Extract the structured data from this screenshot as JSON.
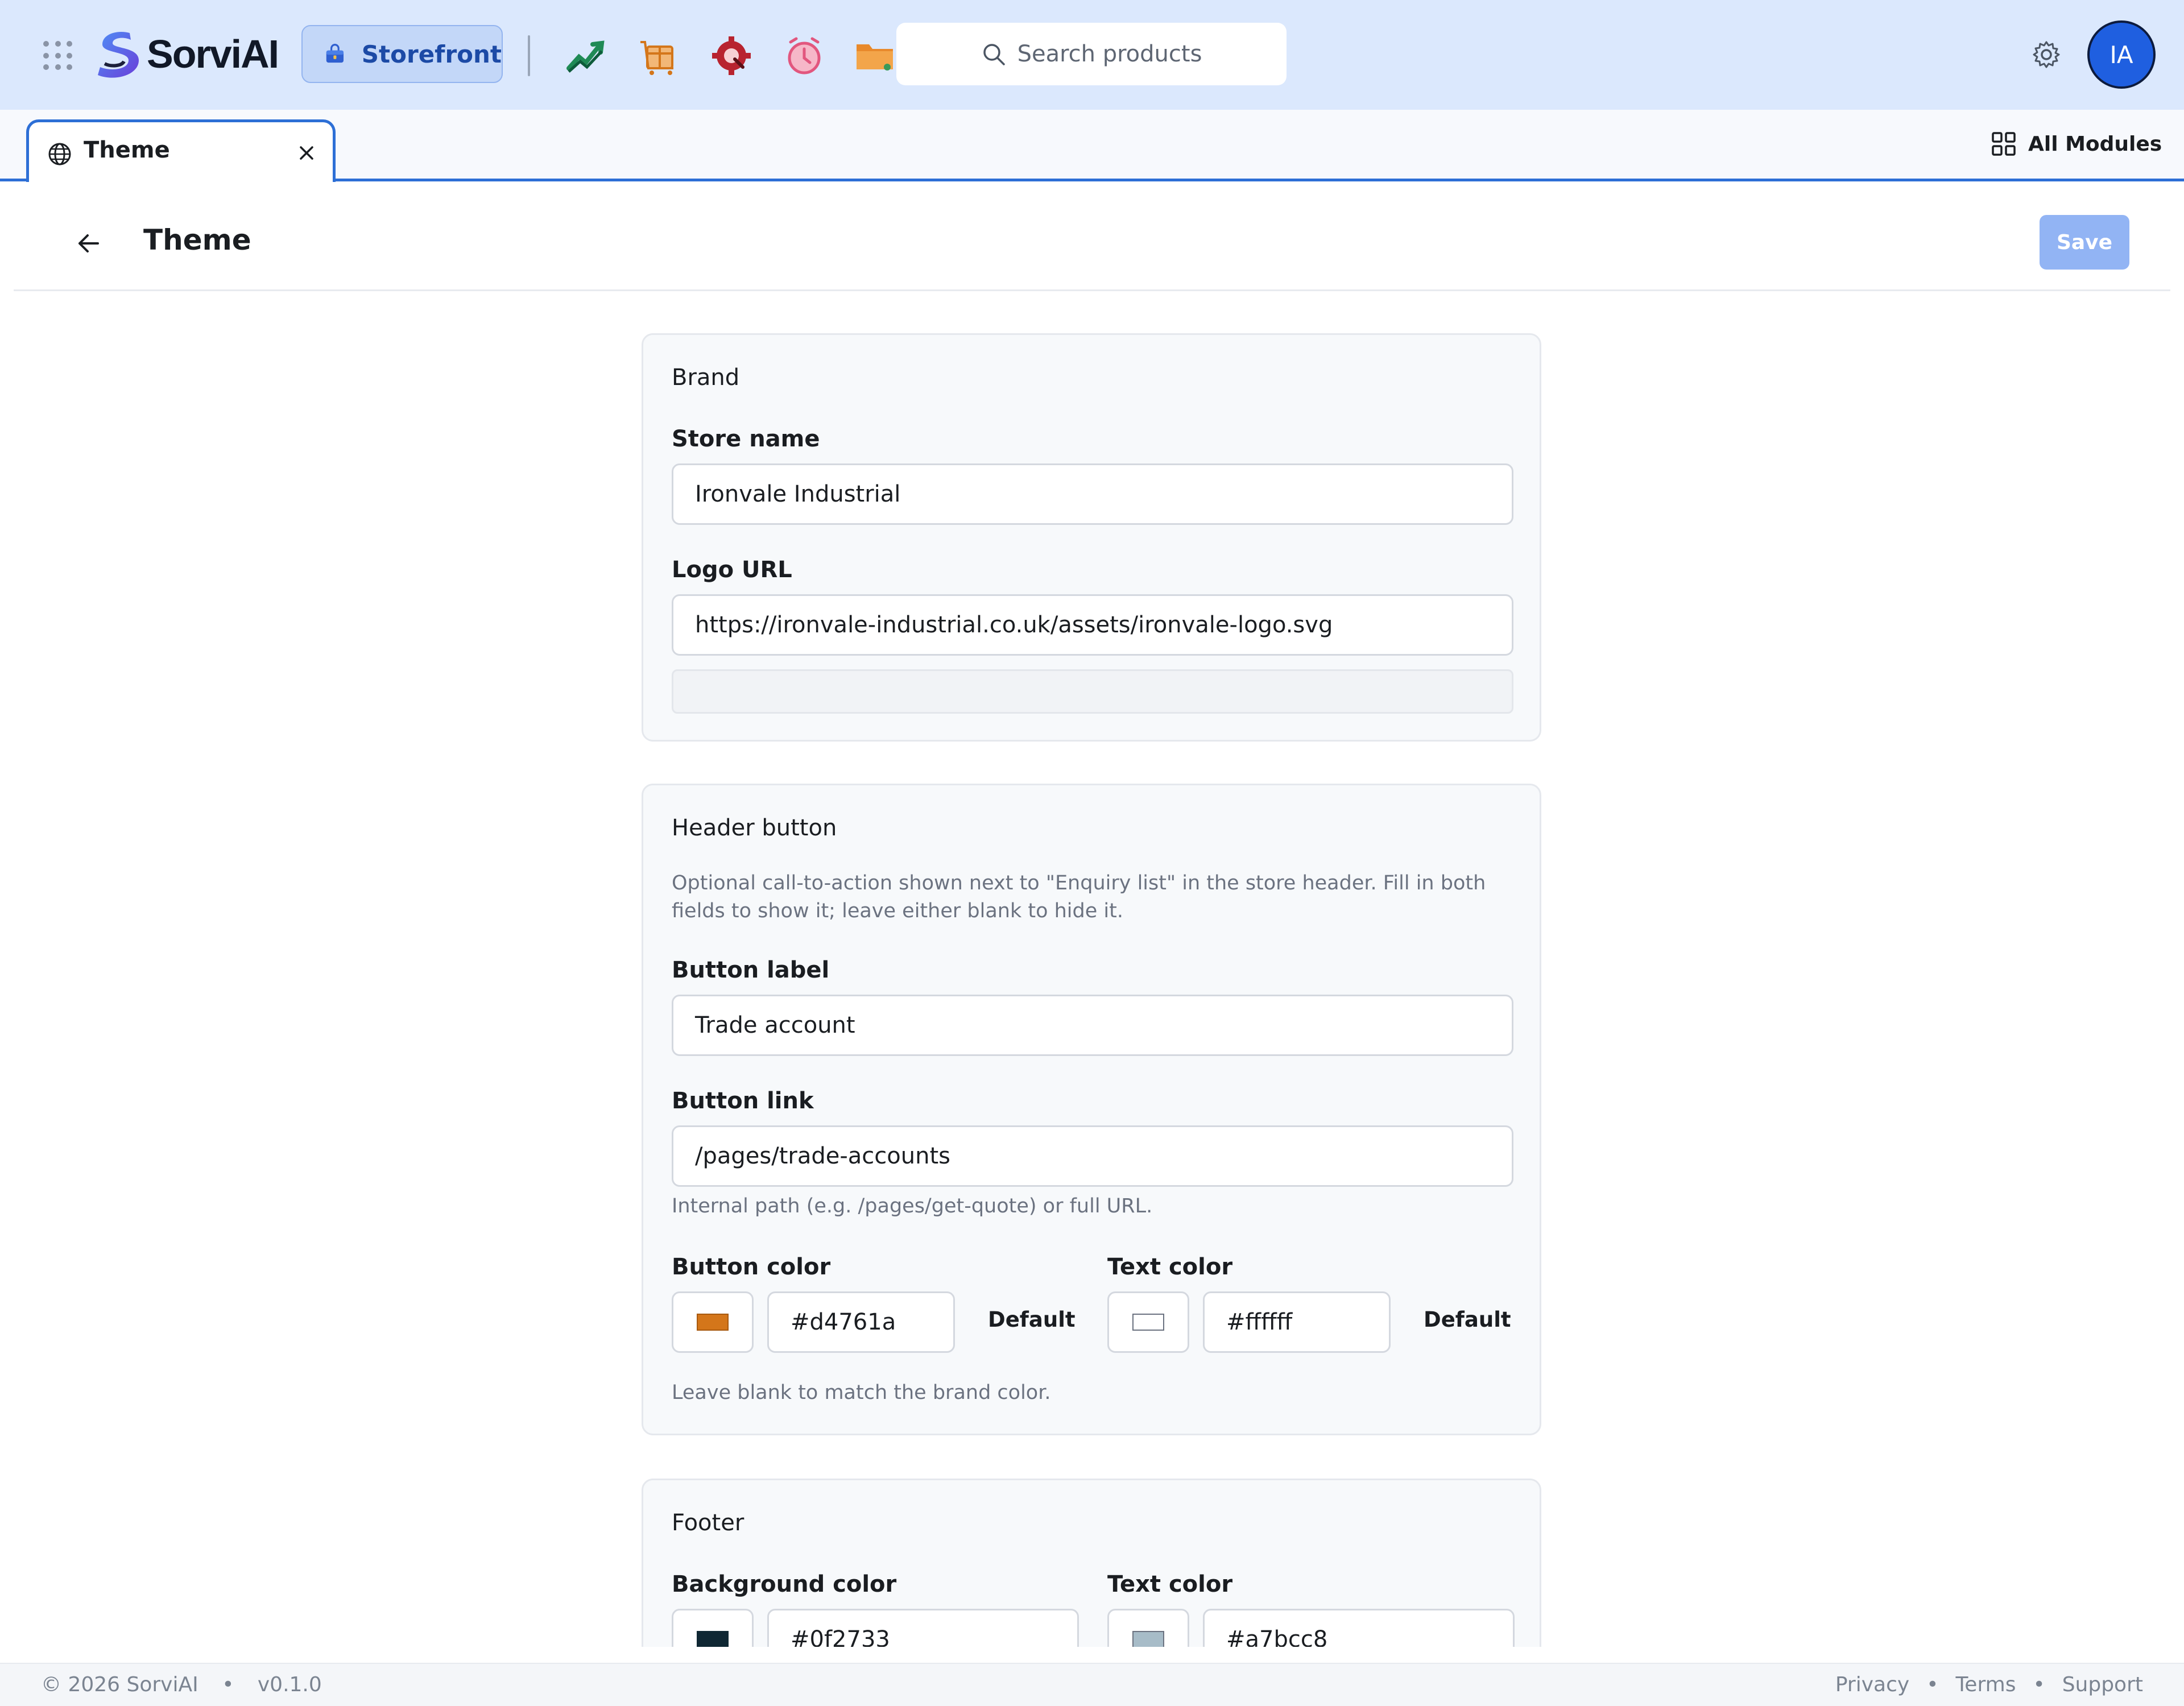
{
  "app": {
    "name": "SorviAI",
    "module": "Storefront",
    "search_placeholder": "Search products",
    "user_initials": "IA"
  },
  "colors": {
    "accent": "#2d6fd6",
    "save_disabled": "#92b4f4",
    "topbar": "#dbe8fd"
  },
  "icons": {
    "apps": "apps-grid-icon",
    "modules": [
      "analytics-chart-icon",
      "inventory-box-icon",
      "service-gear-icon",
      "timer-alarm-icon",
      "files-folder-icon"
    ],
    "settings": "gear-icon"
  },
  "tabs": [
    {
      "title": "Theme",
      "icon": "globe-icon"
    }
  ],
  "all_modules_label": "All Modules",
  "page": {
    "title": "Theme",
    "save_label": "Save"
  },
  "brand": {
    "title": "Brand",
    "store_name_label": "Store name",
    "store_name_value": "Ironvale Industrial",
    "logo_url_label": "Logo URL",
    "logo_url_value": "https://ironvale-industrial.co.uk/assets/ironvale-logo.svg"
  },
  "header_button": {
    "title": "Header button",
    "description": "Optional call-to-action shown next to \"Enquiry list\" in the store header. Fill in both fields to show it; leave either blank to hide it.",
    "label_label": "Button label",
    "label_value": "Trade account",
    "link_label": "Button link",
    "link_value": "/pages/trade-accounts",
    "link_hint": "Internal path (e.g. /pages/get-quote) or full URL.",
    "button_color_label": "Button color",
    "button_color_value": "#d4761a",
    "text_color_label": "Text color",
    "text_color_value": "#ffffff",
    "default_label": "Default",
    "color_hint": "Leave blank to match the brand color."
  },
  "footer_section": {
    "title": "Footer",
    "bg_color_label": "Background color",
    "bg_color_value": "#0f2733",
    "text_color_label": "Text color",
    "text_color_value": "#a7bcc8"
  },
  "footer": {
    "copyright": "© 2026 SorviAI",
    "version": "v0.1.0",
    "links": [
      "Privacy",
      "Terms",
      "Support"
    ]
  }
}
